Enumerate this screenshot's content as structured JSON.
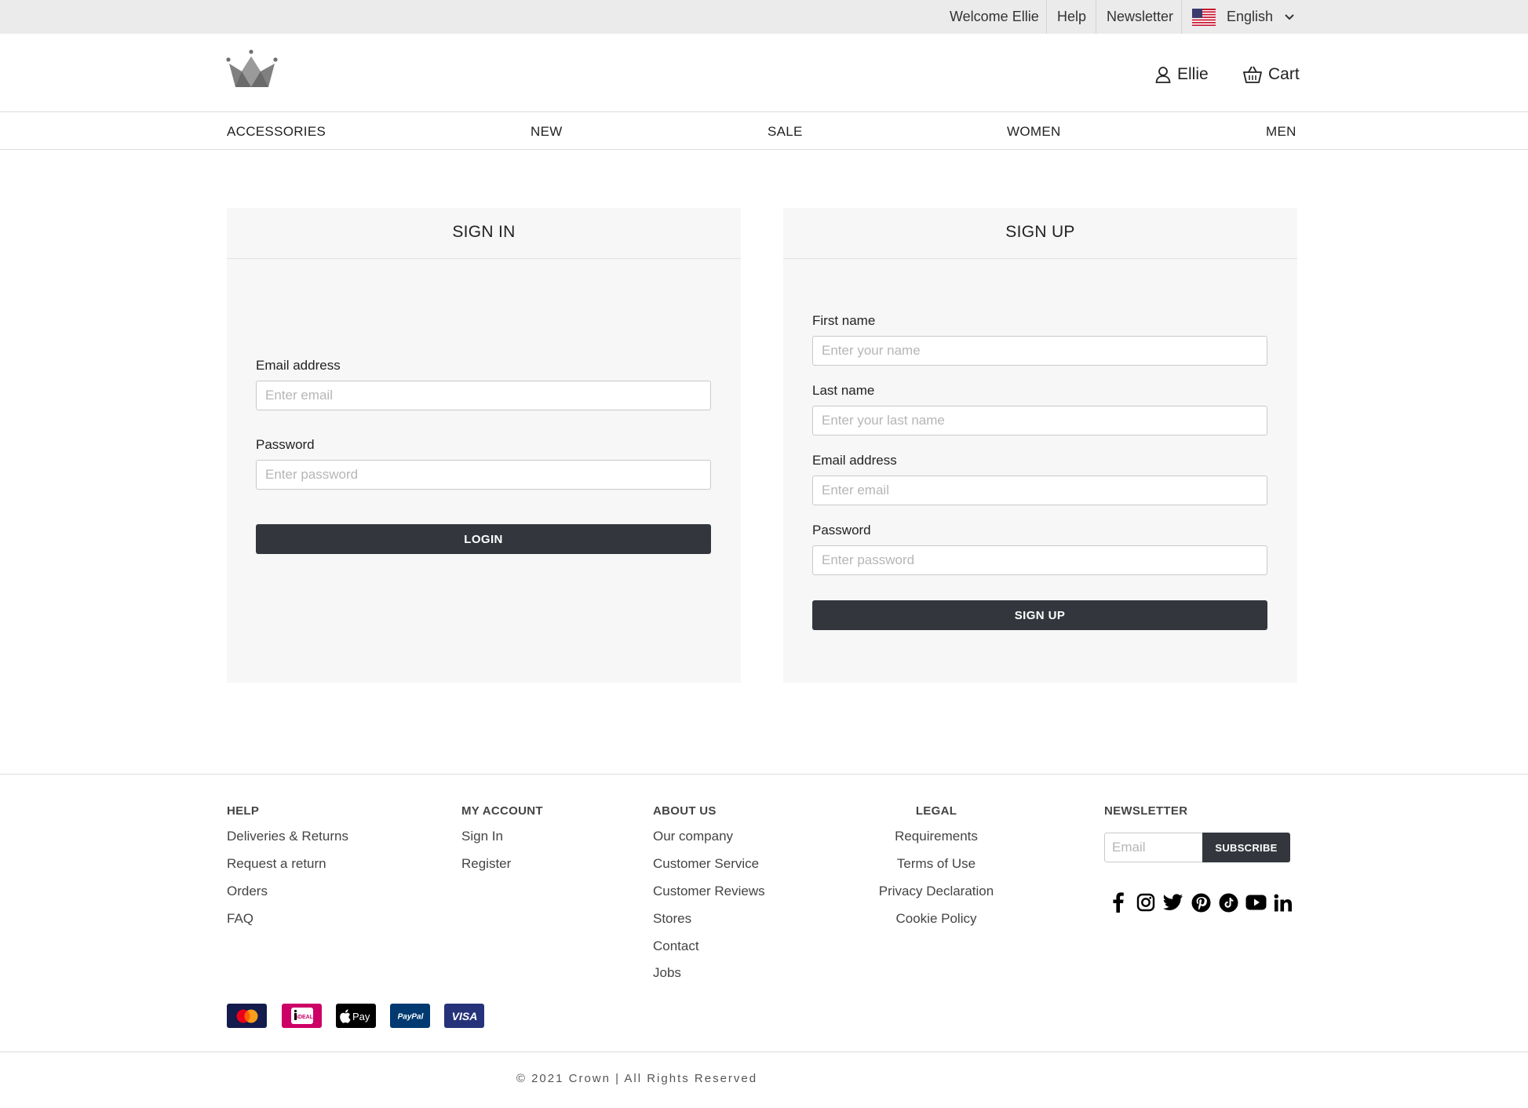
{
  "topbar": {
    "welcome": "Welcome Ellie",
    "help": "Help",
    "newsletter": "Newsletter",
    "language": "English",
    "flag_icon": "us-flag-icon"
  },
  "header": {
    "logo_icon": "crown-logo-icon",
    "account_label": "Ellie",
    "cart_label": "Cart"
  },
  "nav": {
    "items": [
      "ACCESSORIES",
      "NEW",
      "SALE",
      "WOMEN",
      "MEN"
    ]
  },
  "signin": {
    "title": "SIGN IN",
    "email_label": "Email address",
    "email_placeholder": "Enter email",
    "password_label": "Password",
    "password_placeholder": "Enter password",
    "button": "LOGIN"
  },
  "signup": {
    "title": "SIGN UP",
    "first_label": "First name",
    "first_placeholder": "Enter your name",
    "last_label": "Last name",
    "last_placeholder": "Enter your last name",
    "email_label": "Email address",
    "email_placeholder": "Enter email",
    "password_label": "Password",
    "password_placeholder": "Enter password",
    "button": "SIGN UP"
  },
  "footer": {
    "help": {
      "title": "HELP",
      "links": [
        "Deliveries & Returns",
        "Request a return",
        "Orders",
        "FAQ"
      ]
    },
    "account": {
      "title": "MY ACCOUNT",
      "links": [
        "Sign In",
        "Register"
      ]
    },
    "about": {
      "title": "ABOUT US",
      "links": [
        "Our company",
        "Customer Service",
        "Customer Reviews",
        "Stores",
        "Contact",
        "Jobs"
      ]
    },
    "legal": {
      "title": "LEGAL",
      "links": [
        "Requirements",
        "Terms of Use",
        "Privacy Declaration",
        "Cookie Policy"
      ]
    },
    "newsletter": {
      "title": "NEWSLETTER",
      "placeholder": "Email",
      "button": "SUBSCRIBE"
    },
    "social_icons": [
      "facebook-icon",
      "instagram-icon",
      "twitter-icon",
      "pinterest-icon",
      "tiktok-icon",
      "youtube-icon",
      "linkedin-icon"
    ],
    "payments": {
      "methods": [
        "mastercard-icon",
        "ideal-icon",
        "apple-pay-icon",
        "paypal-icon",
        "visa-icon"
      ],
      "ideal_text": "iDEAL",
      "apple_pay_text": "Pay",
      "paypal_text": "PayPal",
      "visa_text": "VISA"
    },
    "copyright": "© 2021 Crown | All Rights Reserved"
  },
  "colors": {
    "topbar_bg": "#ebebeb",
    "panel_bg": "#f7f7f7",
    "button_dark": "#33373d",
    "text": "#222222"
  }
}
